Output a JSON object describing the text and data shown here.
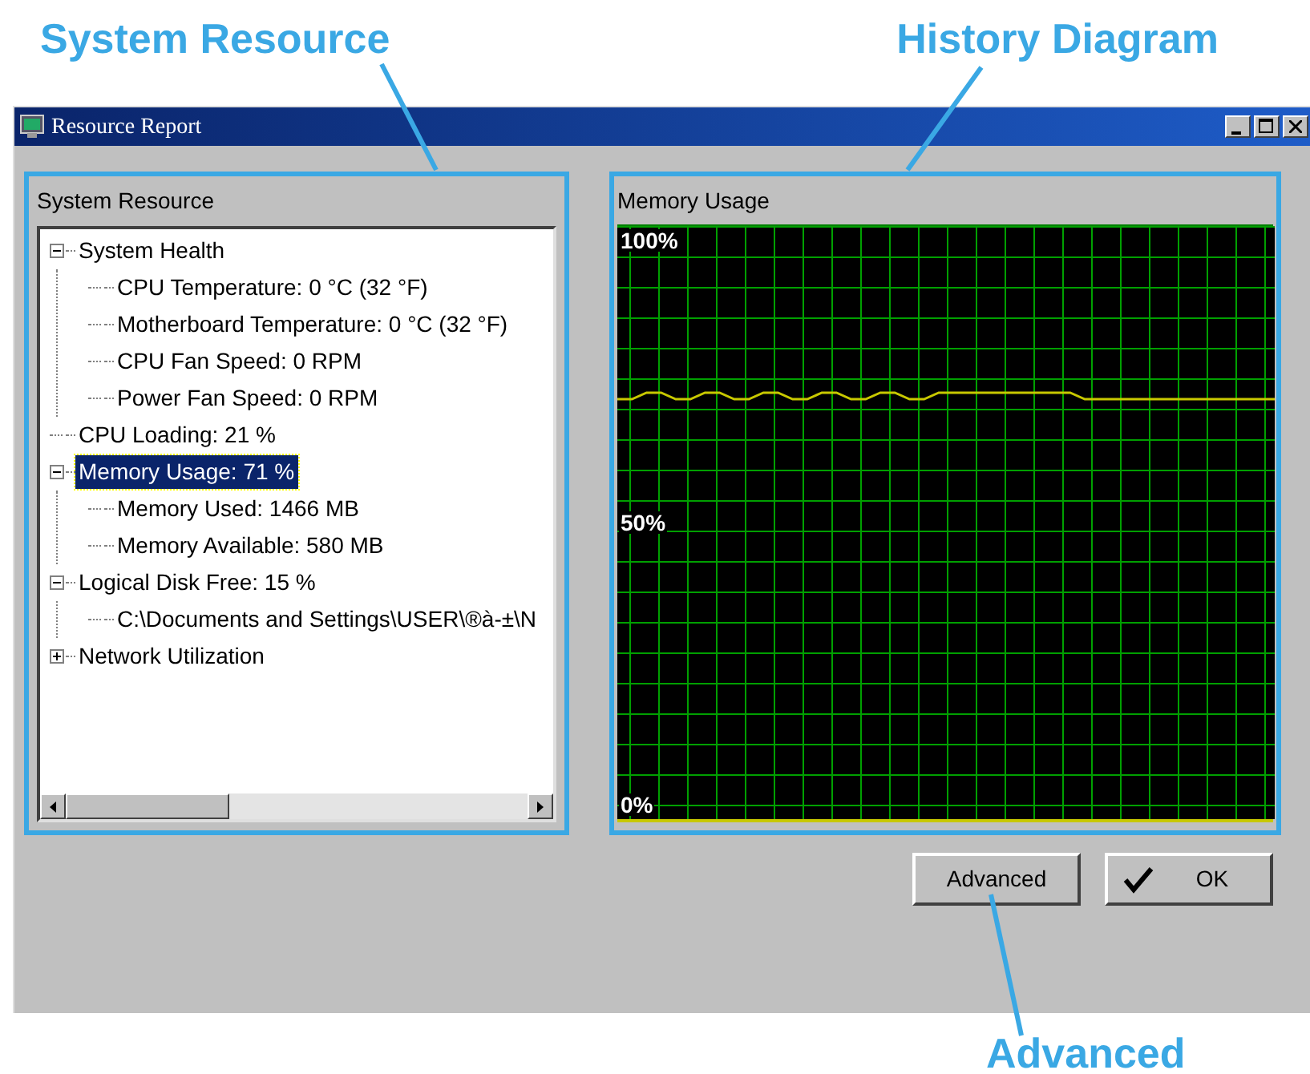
{
  "callouts": [
    {
      "label": "System Resource"
    },
    {
      "label": "History Diagram"
    },
    {
      "label": "Advanced"
    }
  ],
  "window": {
    "title": "Resource Report"
  },
  "system_resource": {
    "title": "System Resource",
    "tree": [
      {
        "label": "System Health",
        "expanded": true,
        "selected": false,
        "children": [
          {
            "label": "CPU Temperature: 0 °C (32 °F)",
            "selected": false
          },
          {
            "label": "Motherboard Temperature: 0 °C (32 °F)",
            "selected": false
          },
          {
            "label": "CPU Fan Speed: 0 RPM",
            "selected": false
          },
          {
            "label": "Power Fan Speed: 0 RPM",
            "selected": false
          }
        ]
      },
      {
        "label": "CPU Loading: 21 %",
        "selected": false
      },
      {
        "label": "Memory Usage: 71 %",
        "expanded": true,
        "selected": true,
        "children": [
          {
            "label": "Memory Used: 1466 MB",
            "selected": false
          },
          {
            "label": "Memory Available: 580 MB",
            "selected": false
          }
        ]
      },
      {
        "label": "Logical Disk Free: 15 %",
        "expanded": true,
        "selected": false,
        "children": [
          {
            "label": "C:\\Documents and Settings\\USER\\®à-±\\N",
            "selected": false
          }
        ]
      },
      {
        "label": "Network Utilization",
        "expanded": false,
        "selected": false
      }
    ]
  },
  "history": {
    "title": "Memory Usage",
    "scale_labels": [
      "100%",
      "50%",
      "0%"
    ]
  },
  "buttons": [
    {
      "label": "Advanced",
      "kind": "plain"
    },
    {
      "label": "OK",
      "kind": "check"
    }
  ]
}
